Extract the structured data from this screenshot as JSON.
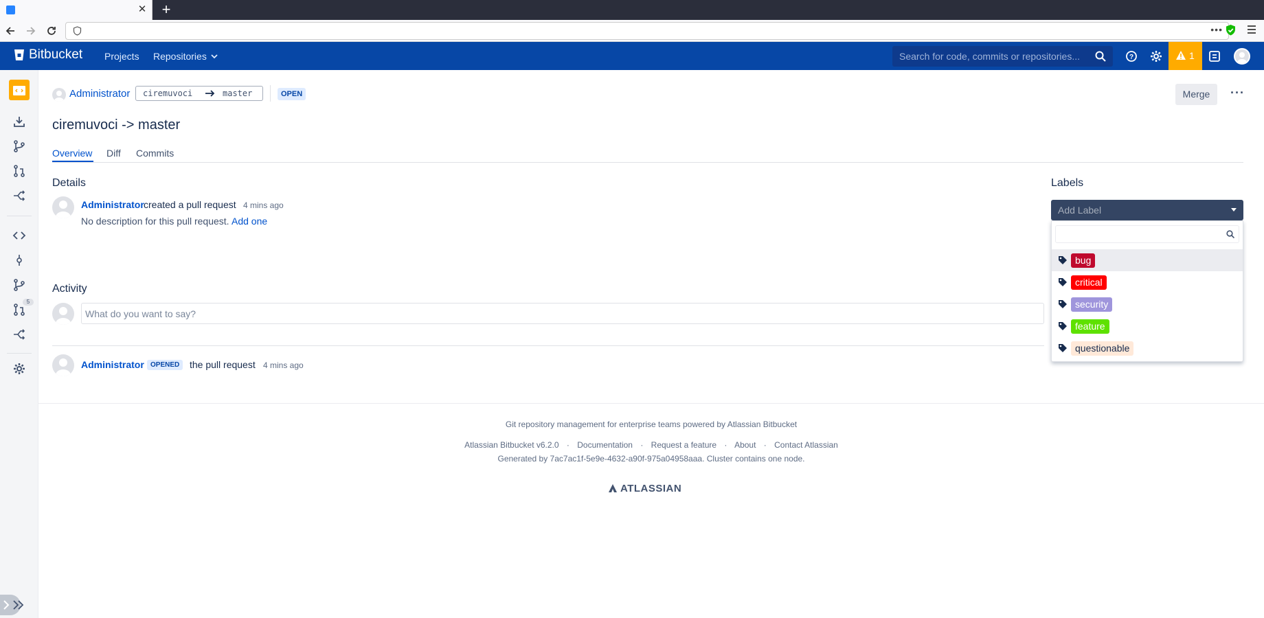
{
  "browser": {
    "tab_close": "✕",
    "new_tab": "+",
    "url": "",
    "menu_dots": "•••"
  },
  "header": {
    "logo": "Bitbucket",
    "nav": [
      "Projects",
      "Repositories"
    ],
    "search_placeholder": "Search for code, commits or repositories...",
    "alert_count": "1",
    "brand_color": "#0747a6"
  },
  "sidebar": {
    "pull_request_count": "5"
  },
  "pull_request": {
    "author": "Administrator",
    "source_branch": "ciremuvoci",
    "target_branch": "master",
    "status": "OPEN",
    "title": "ciremuvoci -> master",
    "merge_label": "Merge",
    "more_label": "···",
    "tabs": [
      "Overview",
      "Diff",
      "Commits"
    ],
    "active_tab": "Overview"
  },
  "details": {
    "heading": "Details",
    "author": "Administrator",
    "action": "created a pull request",
    "time": "4 mins ago",
    "description": "No description for this pull request.",
    "add_link": "Add one"
  },
  "activity": {
    "heading": "Activity",
    "comment_placeholder": "What do you want to say?",
    "entries": [
      {
        "author": "Administrator",
        "badge": "OPENED",
        "text": "the pull request",
        "time": "4 mins ago"
      }
    ]
  },
  "labels": {
    "heading": "Labels",
    "placeholder": "Add Label",
    "search_value": "",
    "items": [
      {
        "name": "bug",
        "bg": "#bf0a2e",
        "fg": "#ffffff"
      },
      {
        "name": "critical",
        "bg": "#ff0000",
        "fg": "#ffffff"
      },
      {
        "name": "security",
        "bg": "#9f95dc",
        "fg": "#ffffff"
      },
      {
        "name": "feature",
        "bg": "#5ee100",
        "fg": "#ffffff"
      },
      {
        "name": "questionable",
        "bg": "#ffe9d9",
        "fg": "#172b4d"
      }
    ]
  },
  "footer": {
    "tagline": "Git repository management for enterprise teams powered by Atlassian Bitbucket",
    "links": [
      "Atlassian Bitbucket v6.2.0",
      "Documentation",
      "Request a feature",
      "About",
      "Contact Atlassian"
    ],
    "separator": "·",
    "generated": "Generated by 7ac7ac1f-5e9e-4632-a90f-975a04958aaa. Cluster contains one node.",
    "brand": "ATLASSIAN"
  }
}
